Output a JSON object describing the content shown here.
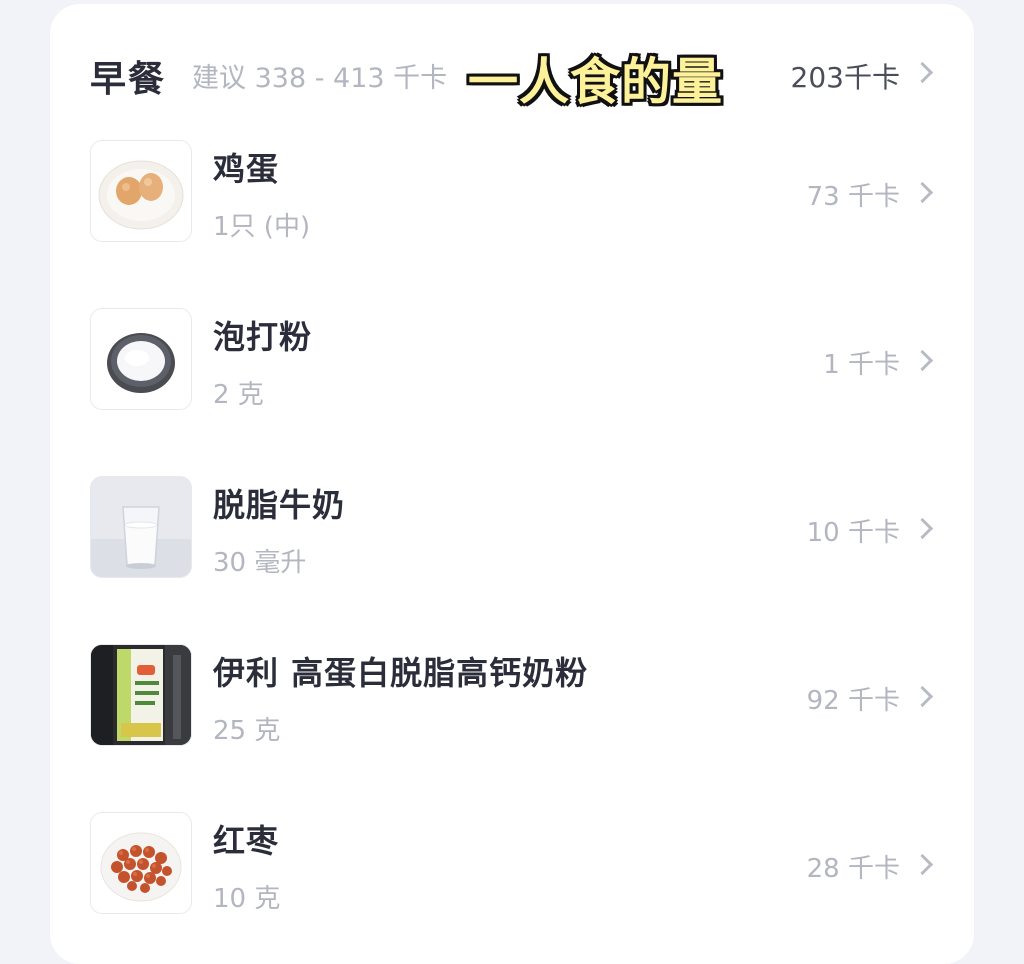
{
  "meal": {
    "title": "早餐",
    "suggestion": "建议 338 - 413 千卡",
    "total": "203千卡"
  },
  "overlay_caption": "一人食的量",
  "items": [
    {
      "name": "鸡蛋",
      "amount": "1只 (中)",
      "kcal": "73 千卡",
      "icon": "eggs-icon"
    },
    {
      "name": "泡打粉",
      "amount": "2 克",
      "kcal": "1 千卡",
      "icon": "baking-powder-icon"
    },
    {
      "name": "脱脂牛奶",
      "amount": "30 毫升",
      "kcal": "10 千卡",
      "icon": "milk-glass-icon"
    },
    {
      "name": "伊利 高蛋白脱脂高钙奶粉",
      "amount": "25 克",
      "kcal": "92 千卡",
      "icon": "milk-powder-bag-icon"
    },
    {
      "name": "红枣",
      "amount": "10 克",
      "kcal": "28 千卡",
      "icon": "red-dates-icon"
    }
  ],
  "colors": {
    "background": "#f2f3f8",
    "card": "#ffffff",
    "title_text": "#2b2d3a",
    "muted_text": "#b3b6c0",
    "caption_fill": "#fdf29a"
  }
}
